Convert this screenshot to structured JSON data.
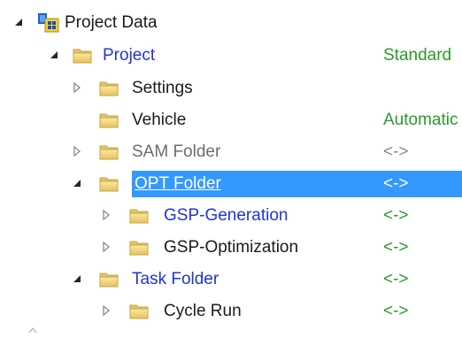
{
  "tree": {
    "root": {
      "label": "Project Data",
      "icon": "project-data-icon",
      "expanded": true
    },
    "items": [
      {
        "id": "project",
        "label": "Project",
        "value": "Standard",
        "label_color": "blue",
        "value_color": "green",
        "expanded": true,
        "icon": "folder-icon"
      },
      {
        "id": "settings",
        "label": "Settings",
        "value": "",
        "label_color": "black",
        "expanded": false,
        "icon": "folder-icon"
      },
      {
        "id": "vehicle",
        "label": "Vehicle",
        "value": "Automatic",
        "label_color": "black",
        "value_color": "green",
        "icon": "folder-icon"
      },
      {
        "id": "sam-folder",
        "label": "SAM Folder",
        "value": "<->",
        "label_color": "gray",
        "value_color": "gray",
        "expanded": false,
        "icon": "folder-icon"
      },
      {
        "id": "opt-folder",
        "label": "OPT Folder",
        "value": "<->",
        "selected": true,
        "expanded": true,
        "icon": "folder-icon"
      },
      {
        "id": "gsp-generation",
        "label": "GSP-Generation",
        "value": "<->",
        "label_color": "blue",
        "value_color": "green",
        "expanded": false,
        "icon": "folder-icon"
      },
      {
        "id": "gsp-optimization",
        "label": "GSP-Optimization",
        "value": "<->",
        "label_color": "black",
        "value_color": "green",
        "expanded": false,
        "icon": "folder-icon"
      },
      {
        "id": "task-folder",
        "label": "Task Folder",
        "value": "<->",
        "label_color": "blue",
        "value_color": "green",
        "expanded": true,
        "icon": "folder-icon"
      },
      {
        "id": "cycle-run",
        "label": "Cycle Run",
        "value": "<->",
        "label_color": "black",
        "value_color": "green",
        "expanded": false,
        "icon": "folder-icon"
      }
    ]
  },
  "colors": {
    "selection": "#3399ff",
    "link_blue": "#1f35d6",
    "value_green": "#2a9a2a",
    "muted_gray": "#6d6d6d",
    "folder_body": "#f0d77c"
  }
}
